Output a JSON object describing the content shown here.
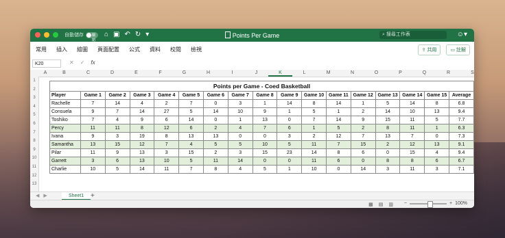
{
  "window": {
    "title": "Points Per Game",
    "autosave_label": "自動儲存",
    "autosave_state": "關閉",
    "search_placeholder": "搜尋工作表",
    "colors": {
      "accent": "#217346",
      "green_row": "#e2efda"
    }
  },
  "ribbon": {
    "tabs": [
      "常用",
      "插入",
      "繪圖",
      "頁面配置",
      "公式",
      "資料",
      "校閱",
      "檢視"
    ],
    "share_label": "共用",
    "comment_label": "註解"
  },
  "formula_bar": {
    "name_box": "K20",
    "fx": "fx",
    "cancel": "✕",
    "confirm": "✓",
    "value": ""
  },
  "grid": {
    "columns": [
      "A",
      "B",
      "C",
      "D",
      "E",
      "F",
      "G",
      "H",
      "I",
      "J",
      "K",
      "L",
      "M",
      "N",
      "O",
      "P",
      "Q",
      "R",
      "S"
    ],
    "selected_column": "K",
    "rows": [
      "1",
      "2",
      "3",
      "4",
      "5",
      "6",
      "7",
      "8",
      "9",
      "10",
      "11",
      "12",
      "13"
    ]
  },
  "table": {
    "title": "Points per Game - Coed Basketball",
    "headers": [
      "Player",
      "Game 1",
      "Game 2",
      "Game 3",
      "Game 4",
      "Game 5",
      "Game 6",
      "Game 7",
      "Game 8",
      "Game 9",
      "Game 10",
      "Game 11",
      "Game 12",
      "Game 13",
      "Game 14",
      "Game 15",
      "Average"
    ],
    "rows": [
      [
        "Rachelle",
        "7",
        "14",
        "4",
        "2",
        "7",
        "0",
        "3",
        "1",
        "14",
        "8",
        "14",
        "1",
        "5",
        "14",
        "8",
        "6.8"
      ],
      [
        "Consuela",
        "9",
        "7",
        "14",
        "27",
        "5",
        "14",
        "10",
        "9",
        "1",
        "5",
        "1",
        "2",
        "14",
        "10",
        "13",
        "9.4"
      ],
      [
        "Toshiko",
        "7",
        "4",
        "9",
        "6",
        "14",
        "0",
        "1",
        "13",
        "0",
        "7",
        "14",
        "9",
        "15",
        "11",
        "5",
        "7.7"
      ],
      [
        "Percy",
        "11",
        "11",
        "8",
        "12",
        "6",
        "2",
        "4",
        "7",
        "6",
        "1",
        "5",
        "2",
        "8",
        "11",
        "1",
        "6.3"
      ],
      [
        "Ivana",
        "9",
        "3",
        "19",
        "8",
        "13",
        "13",
        "0",
        "0",
        "3",
        "2",
        "12",
        "7",
        "13",
        "7",
        "0",
        "7.3"
      ],
      [
        "Samantha",
        "13",
        "15",
        "12",
        "7",
        "4",
        "5",
        "5",
        "10",
        "5",
        "11",
        "7",
        "15",
        "2",
        "12",
        "13",
        "9.1"
      ],
      [
        "Pilar",
        "11",
        "9",
        "13",
        "3",
        "15",
        "2",
        "3",
        "15",
        "23",
        "14",
        "8",
        "6",
        "0",
        "15",
        "4",
        "9.4"
      ],
      [
        "Garrett",
        "3",
        "6",
        "13",
        "10",
        "5",
        "11",
        "14",
        "0",
        "0",
        "11",
        "6",
        "0",
        "8",
        "8",
        "6",
        "6.7"
      ],
      [
        "Charlie",
        "10",
        "5",
        "14",
        "11",
        "7",
        "8",
        "4",
        "5",
        "1",
        "10",
        "0",
        "14",
        "3",
        "11",
        "3",
        "7.1"
      ]
    ],
    "green_rows": [
      3,
      5,
      7
    ]
  },
  "sheet_tabs": {
    "active": "Sheet1",
    "add": "+"
  },
  "status": {
    "zoom": "100%"
  }
}
